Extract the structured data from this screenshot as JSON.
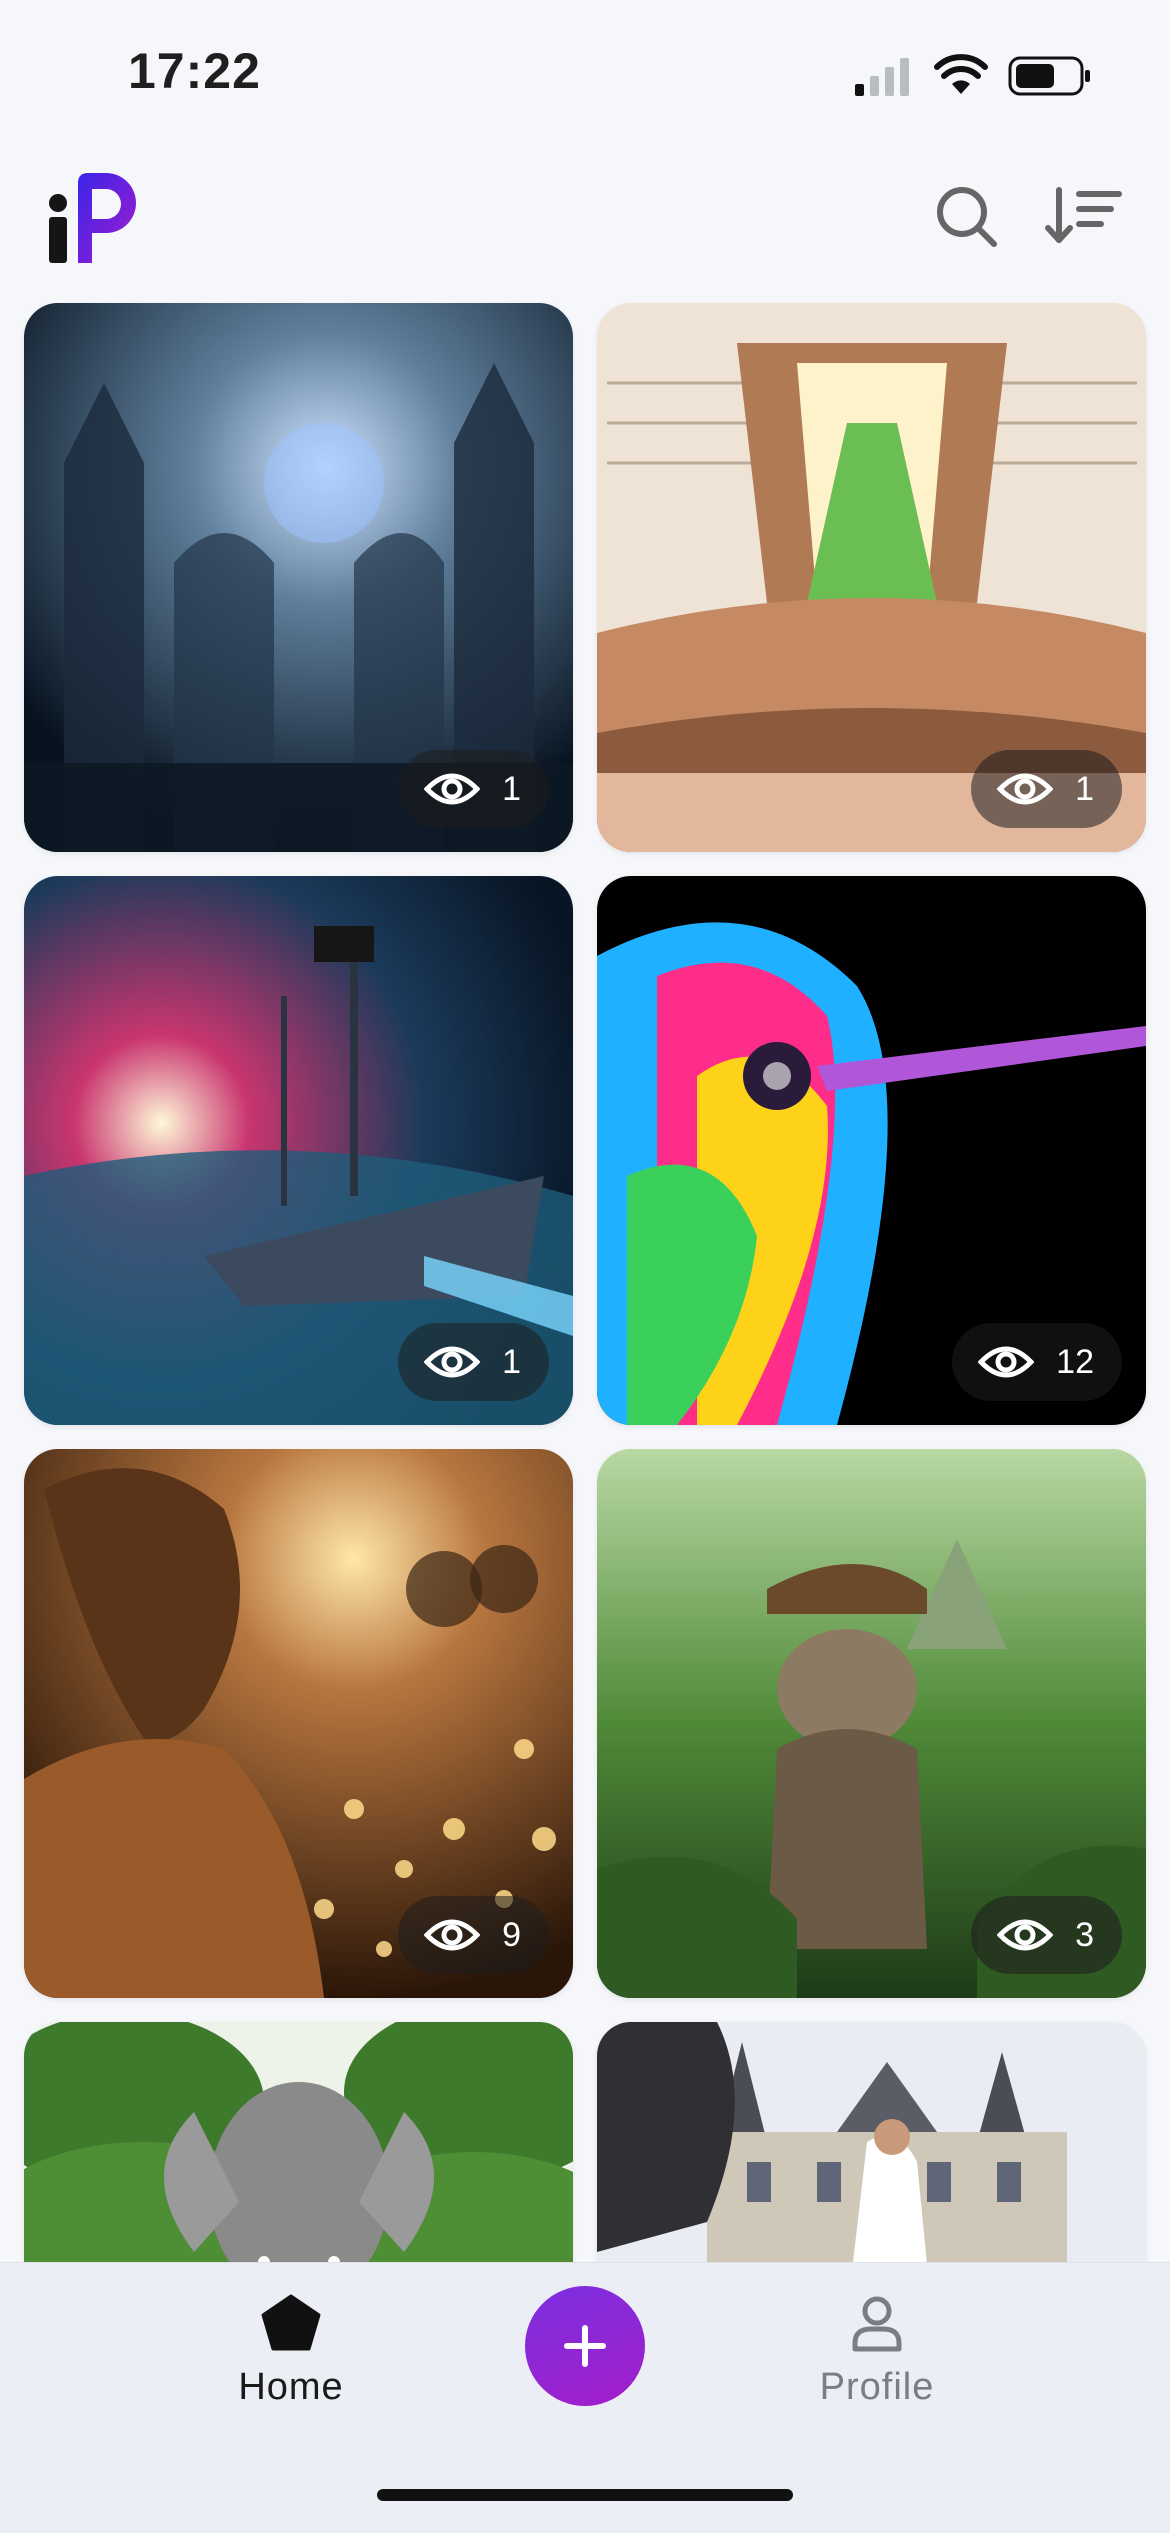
{
  "status_bar": {
    "time": "17:22"
  },
  "header": {
    "logo_icon": "ip-logo",
    "search_icon": "search-icon",
    "sort_icon": "sort-icon"
  },
  "cards": [
    {
      "title": "Gothic cathedral ruins",
      "views": "1",
      "colors": [
        "#0b1a2b",
        "#5f7f9c",
        "#dbe8ff"
      ]
    },
    {
      "title": "Forest inside book",
      "views": "1",
      "colors": [
        "#efe6d9",
        "#b07a55",
        "#8fcf6a"
      ]
    },
    {
      "title": "Pirate spaceship",
      "views": "1",
      "colors": [
        "#0d1f33",
        "#7ad7ff",
        "#c9356f"
      ]
    },
    {
      "title": "Rainbow hummingbird",
      "views": "12",
      "colors": [
        "#000000",
        "#1fb0ff",
        "#ff2d8a"
      ]
    },
    {
      "title": "Woman with film camera",
      "views": "9",
      "colors": [
        "#3a2210",
        "#b8763f",
        "#ffd27a"
      ]
    },
    {
      "title": "Explorer kitten",
      "views": "3",
      "colors": [
        "#1e3a18",
        "#7fbd5a",
        "#6b4a2b"
      ]
    },
    {
      "title": "Elephant in tree",
      "views": "",
      "colors": [
        "#3d7a2c",
        "#8a8a8a",
        "#ffffff"
      ]
    },
    {
      "title": "Wedding at castle",
      "views": "",
      "colors": [
        "#e9ecf2",
        "#2f2f34",
        "#cfc7b8"
      ]
    }
  ],
  "bottom_nav": {
    "home_label": "Home",
    "profile_label": "Profile",
    "add_icon": "plus-icon",
    "accent": "#8a24d6"
  }
}
